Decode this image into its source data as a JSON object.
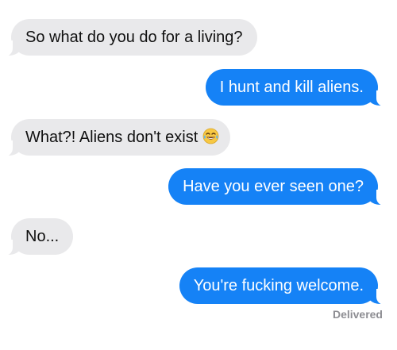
{
  "conversation": {
    "messages": [
      {
        "direction": "incoming",
        "text": "So what do you do for a living?"
      },
      {
        "direction": "outgoing",
        "text": "I hunt and kill aliens."
      },
      {
        "direction": "incoming",
        "text": "What?! Aliens don't exist",
        "emoji": "laughing-crying-face-icon"
      },
      {
        "direction": "outgoing",
        "text": "Have you ever seen one?"
      },
      {
        "direction": "incoming",
        "text": "No..."
      },
      {
        "direction": "outgoing",
        "text": "You're fucking welcome."
      }
    ],
    "status": "Delivered"
  },
  "colors": {
    "incoming_bubble": "#e9e9eb",
    "outgoing_bubble": "#1582f6",
    "status_text": "#8e8e93"
  }
}
